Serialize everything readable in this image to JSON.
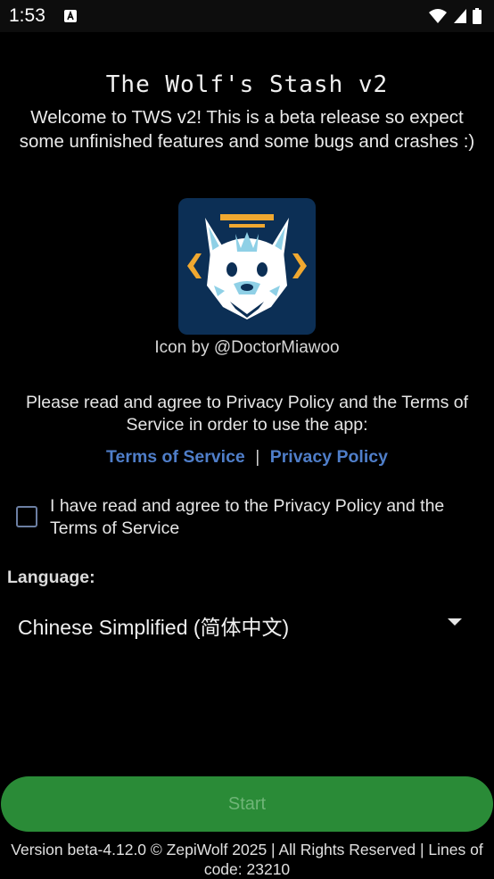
{
  "status_bar": {
    "time": "1:53",
    "icons": [
      "notification-a-icon",
      "wifi-icon",
      "signal-icon",
      "battery-icon"
    ]
  },
  "app": {
    "title": "The Wolf's Stash v2",
    "welcome": "Welcome to TWS v2! This is a beta release so expect some unfinished features and some bugs and crashes :)",
    "icon_credit": "Icon by @DoctorMiawoo"
  },
  "agreement": {
    "intro": "Please read and agree to Privacy Policy and the Terms of Service in order to use the app:",
    "terms_link": "Terms of Service",
    "separator": "|",
    "privacy_link": "Privacy Policy",
    "checkbox_label": "I have read and agree to the Privacy Policy and the Terms of Service",
    "checked": false
  },
  "language": {
    "label": "Language:",
    "selected": "Chinese Simplified (简体中文)"
  },
  "start_button": {
    "label": "Start",
    "enabled": false
  },
  "footer": {
    "text": "Version beta-4.12.0 © ZepiWolf 2025 | All Rights Reserved | Lines of code: 23210"
  },
  "colors": {
    "background": "#000000",
    "accent_link": "#4f7ec9",
    "button": "#2a8b37",
    "icon_bg": "#0c2f55",
    "icon_accent": "#f0a830"
  }
}
